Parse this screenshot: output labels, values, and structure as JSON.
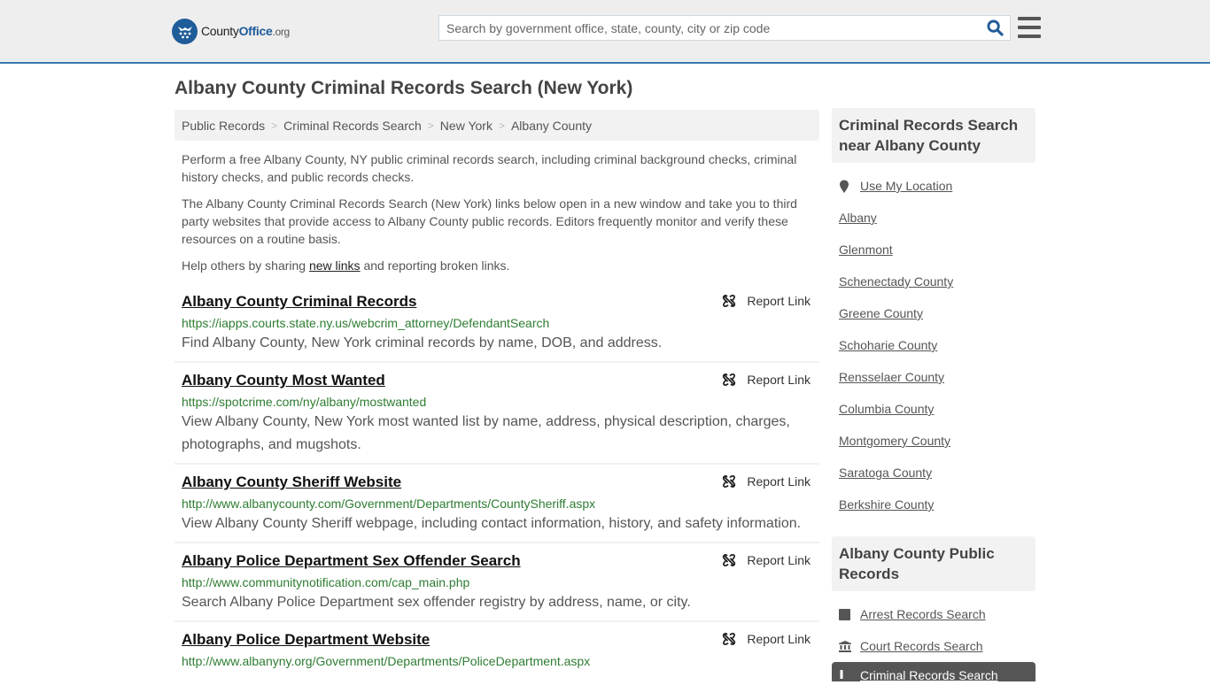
{
  "header": {
    "logo": {
      "county": "County",
      "office": "Office",
      "org": ".org"
    },
    "search": {
      "placeholder": "Search by government office, state, county, city or zip code",
      "value": ""
    },
    "icons": {
      "search": "search-icon",
      "menu": "hamburger-menu-icon",
      "logo": "eagle-stars-logo-icon"
    },
    "accent_color": "#3a7aab"
  },
  "page": {
    "title": "Albany County Criminal Records Search (New York)",
    "breadcrumb": [
      "Public Records",
      "Criminal Records Search",
      "New York",
      "Albany County"
    ],
    "intro": {
      "p1": "Perform a free Albany County, NY public criminal records search, including criminal background checks, criminal history checks, and public records checks.",
      "p2": "The Albany County Criminal Records Search (New York) links below open in a new window and take you to third party websites that provide access to Albany County public records. Editors frequently monitor and verify these resources on a routine basis.",
      "p3_before": "Help others by sharing ",
      "p3_link": "new links",
      "p3_after": " and reporting broken links."
    },
    "report_label": "Report Link",
    "results": [
      {
        "title": "Albany County Criminal Records",
        "url": "https://iapps.courts.state.ny.us/webcrim_attorney/DefendantSearch",
        "desc": "Find Albany County, New York criminal records by name, DOB, and address."
      },
      {
        "title": "Albany County Most Wanted",
        "url": "https://spotcrime.com/ny/albany/mostwanted",
        "desc": "View Albany County, New York most wanted list by name, address, physical description, charges, photographs, and mugshots."
      },
      {
        "title": "Albany County Sheriff Website",
        "url": "http://www.albanycounty.com/Government/Departments/CountySheriff.aspx",
        "desc": "View Albany County Sheriff webpage, including contact information, history, and safety information."
      },
      {
        "title": "Albany Police Department Sex Offender Search",
        "url": "http://www.communitynotification.com/cap_main.php",
        "desc": "Search Albany Police Department sex offender registry by address, name, or city."
      },
      {
        "title": "Albany Police Department Website",
        "url": "http://www.albanyny.org/Government/Departments/PoliceDepartment.aspx",
        "desc": ""
      }
    ]
  },
  "sidebar": {
    "nearby": {
      "heading": "Criminal Records Search near Albany County",
      "use_location": "Use My Location",
      "items": [
        "Albany",
        "Glenmont",
        "Schenectady County",
        "Greene County",
        "Schoharie County",
        "Rensselaer County",
        "Columbia County",
        "Montgomery County",
        "Saratoga County",
        "Berkshire County"
      ]
    },
    "public_records": {
      "heading": "Albany County Public Records",
      "items": [
        {
          "label": "Arrest Records Search",
          "icon": "square-icon"
        },
        {
          "label": "Court Records Search",
          "icon": "courthouse-icon"
        },
        {
          "label": "Criminal Records Search",
          "icon": "exclamation-icon",
          "active": true
        }
      ]
    }
  }
}
